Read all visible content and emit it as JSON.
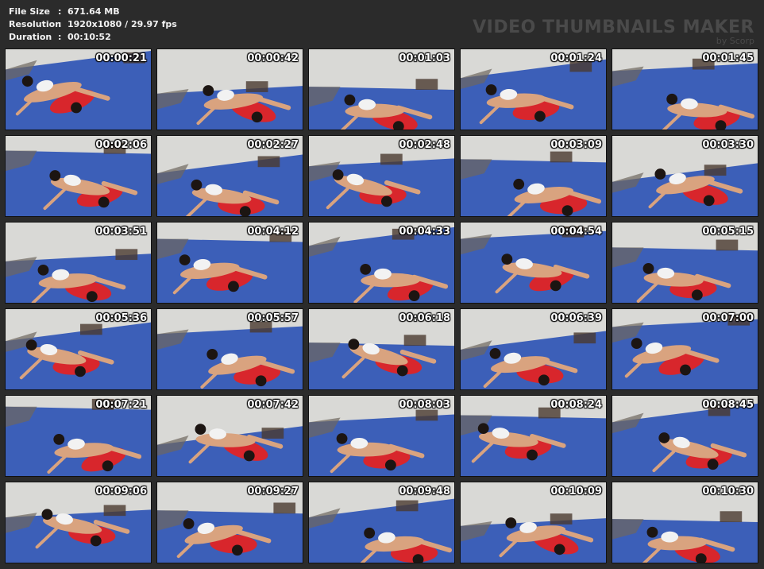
{
  "info": {
    "rows": [
      {
        "label": "File Size",
        "value": "671.64 MB"
      },
      {
        "label": "Resolution",
        "value": "1920x1080 / 29.97 fps"
      },
      {
        "label": "Duration",
        "value": "00:10:52"
      }
    ],
    "colon": ":"
  },
  "brand": {
    "title": "VIDEO THUMBNAILS MAKER",
    "subtitle": "by Scorp"
  },
  "thumbnails": [
    "00:00:21",
    "00:00:42",
    "00:01:03",
    "00:01:24",
    "00:01:45",
    "00:02:06",
    "00:02:27",
    "00:02:48",
    "00:03:09",
    "00:03:30",
    "00:03:51",
    "00:04:12",
    "00:04:33",
    "00:04:54",
    "00:05:15",
    "00:05:36",
    "00:05:57",
    "00:06:18",
    "00:06:39",
    "00:07:00",
    "00:07:21",
    "00:07:42",
    "00:08:03",
    "00:08:24",
    "00:08:45",
    "00:09:06",
    "00:09:27",
    "00:09:48",
    "00:10:09",
    "00:10:30"
  ],
  "colors": {
    "background": "#2b2b2b",
    "mat": "#3c5fb8",
    "wall": "#d9d9d6",
    "floor": "#6e665e",
    "red_shirt": "#d8262c",
    "skin": "#d9a37f",
    "hair": "#1c1512",
    "white_top": "#f2f2f2"
  }
}
